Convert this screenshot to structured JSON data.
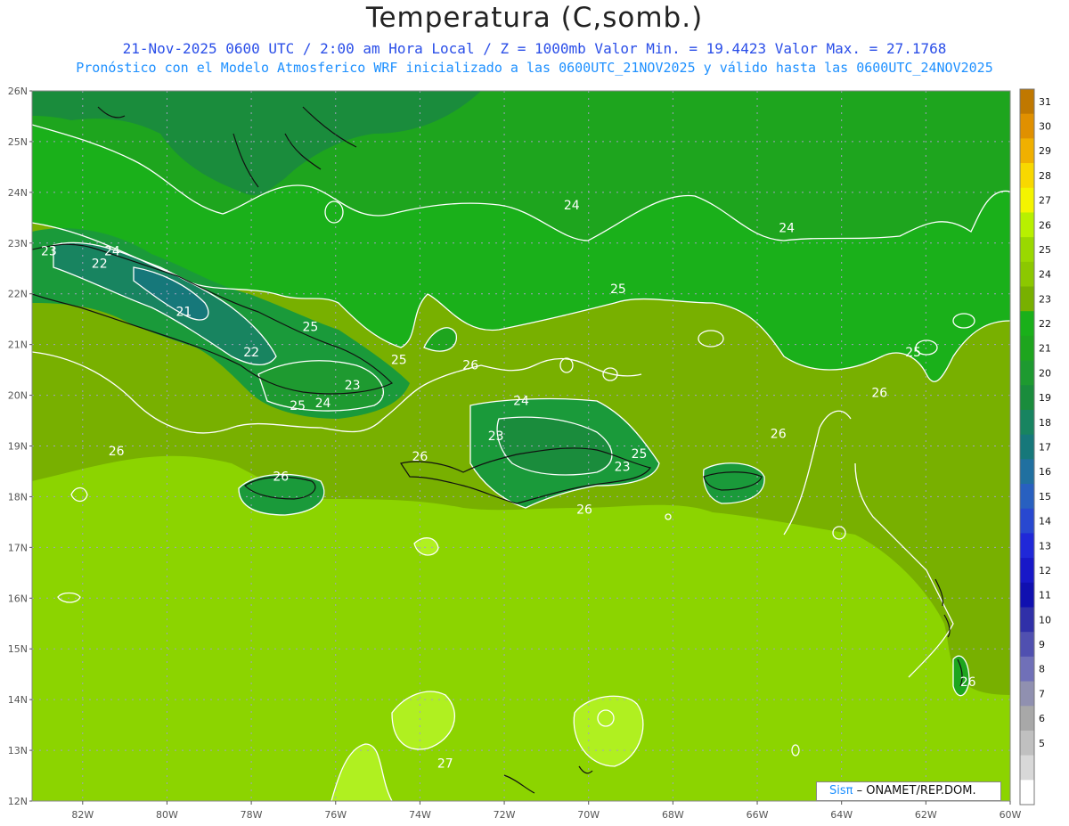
{
  "title": "Temperatura (C,somb.)",
  "subtitle1": "21-Nov-2025  0600 UTC / 2:00 am Hora Local / Z = 1000mb   Valor Min. = 19.4423  Valor Max. = 27.1768",
  "subtitle2": "Pronóstico con el Modelo Atmosferico WRF inicializado a las 0600UTC_21NOV2025 y válido hasta las  0600UTC_24NOV2025",
  "lat_labels": [
    "26N",
    "25N",
    "24N",
    "23N",
    "22N",
    "21N",
    "20N",
    "19N",
    "18N",
    "17N",
    "16N",
    "15N",
    "14N",
    "13N",
    "12N"
  ],
  "lon_labels": [
    "82W",
    "80W",
    "78W",
    "76W",
    "74W",
    "72W",
    "70W",
    "68W",
    "66W",
    "64W",
    "62W",
    "60W"
  ],
  "colorbar": {
    "labels": [
      "31",
      "30",
      "29",
      "28",
      "27",
      "26",
      "25",
      "24",
      "23",
      "22",
      "21",
      "20",
      "19",
      "18",
      "17",
      "16",
      "15",
      "14",
      "13",
      "12",
      "11",
      "10",
      "9",
      "8",
      "7",
      "6",
      "5"
    ],
    "colors": [
      "#c07800",
      "#e09000",
      "#f0b000",
      "#f8d800",
      "#f4f400",
      "#b8f000",
      "#9ad800",
      "#8cc800",
      "#78b000",
      "#1ab01a",
      "#1ea51e",
      "#1e9a30",
      "#1a8c3c",
      "#188460",
      "#16787a",
      "#2070a0",
      "#2860c0",
      "#2848d0",
      "#2028d8",
      "#1818c8",
      "#1010b0",
      "#3030a8",
      "#5050b0",
      "#7070b8",
      "#9090b0",
      "#a8a8a8",
      "#c0c0c0",
      "#d8d8d8",
      "#ffffff"
    ]
  },
  "contour_labels": [
    {
      "text": "24",
      "lon": -70.4,
      "lat": 23.75
    },
    {
      "text": "24",
      "lon": -65.3,
      "lat": 23.3
    },
    {
      "text": "25",
      "lon": -69.3,
      "lat": 22.1
    },
    {
      "text": "25",
      "lon": -62.3,
      "lat": 20.85
    },
    {
      "text": "24",
      "lon": -81.3,
      "lat": 22.85
    },
    {
      "text": "23",
      "lon": -82.8,
      "lat": 22.85
    },
    {
      "text": "22",
      "lon": -81.6,
      "lat": 22.6
    },
    {
      "text": "21",
      "lon": -79.6,
      "lat": 21.65
    },
    {
      "text": "22",
      "lon": -78.0,
      "lat": 20.85
    },
    {
      "text": "25",
      "lon": -76.6,
      "lat": 21.35
    },
    {
      "text": "25",
      "lon": -74.5,
      "lat": 20.7
    },
    {
      "text": "26",
      "lon": -72.8,
      "lat": 20.6
    },
    {
      "text": "23",
      "lon": -75.6,
      "lat": 20.2
    },
    {
      "text": "25",
      "lon": -76.9,
      "lat": 19.8
    },
    {
      "text": "24",
      "lon": -76.3,
      "lat": 19.85
    },
    {
      "text": "26",
      "lon": -81.2,
      "lat": 18.9
    },
    {
      "text": "26",
      "lon": -77.3,
      "lat": 18.4
    },
    {
      "text": "26",
      "lon": -74.0,
      "lat": 18.8
    },
    {
      "text": "24",
      "lon": -71.6,
      "lat": 19.9
    },
    {
      "text": "23",
      "lon": -72.2,
      "lat": 19.2
    },
    {
      "text": "25",
      "lon": -68.8,
      "lat": 18.85
    },
    {
      "text": "23",
      "lon": -69.2,
      "lat": 18.6
    },
    {
      "text": "26",
      "lon": -70.1,
      "lat": 17.75
    },
    {
      "text": "26",
      "lon": -65.5,
      "lat": 19.25
    },
    {
      "text": "26",
      "lon": -63.1,
      "lat": 20.05
    },
    {
      "text": "26",
      "lon": -61.0,
      "lat": 14.35
    },
    {
      "text": "27",
      "lon": -73.4,
      "lat": 12.75
    }
  ],
  "credit": {
    "sis": "Sis",
    "pi": "π",
    "rest": "– ONAMET/REP.DOM."
  }
}
